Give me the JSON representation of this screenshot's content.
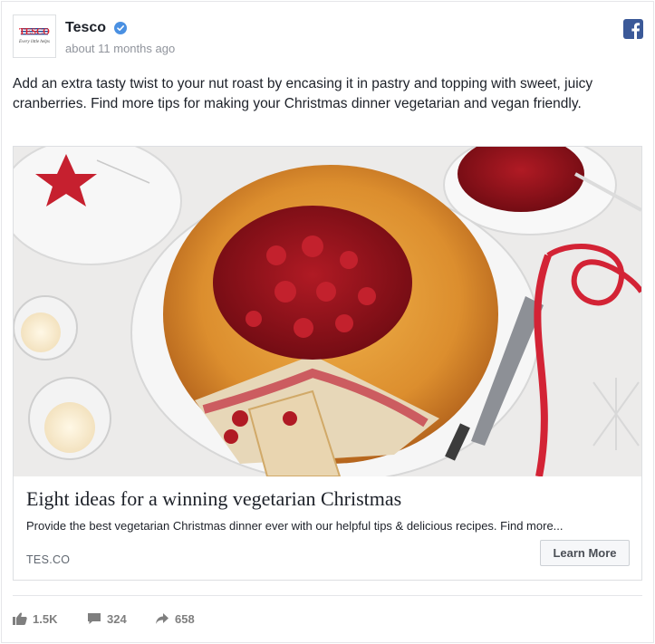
{
  "post": {
    "page_name": "Tesco",
    "timestamp": "about 11 months ago",
    "text": "Add an extra tasty twist to your nut roast by encasing it in pastry and topping with sweet, juicy cranberries. Find more tips for making your Christmas dinner vegetarian and vegan friendly.",
    "logo": {
      "brand_text": "TESCO",
      "tagline": "Every little helps"
    },
    "icons": {
      "verified": "verified-badge-icon",
      "network": "facebook-icon"
    },
    "colors": {
      "verified": "#4a90e2",
      "facebook": "#3b5998"
    }
  },
  "link": {
    "title": "Eight ideas for a winning vegetarian Christmas",
    "description": "Provide the best vegetarian Christmas dinner ever with our helpful tips & delicious recipes. Find more...",
    "domain": "TES.CO",
    "cta_label": "Learn More"
  },
  "engagement": {
    "likes": "1.5K",
    "comments": "324",
    "shares": "658",
    "icons": [
      "like-icon",
      "comment-icon",
      "share-icon"
    ]
  }
}
